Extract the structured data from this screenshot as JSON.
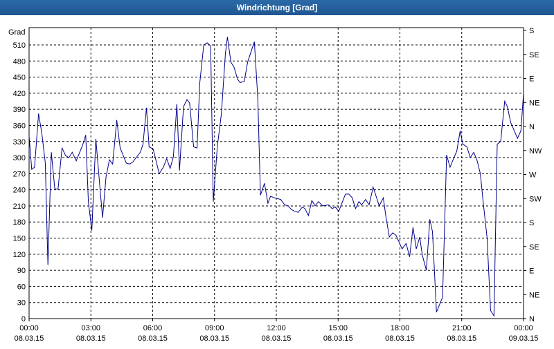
{
  "window": {
    "title": "Windrichtung [Grad]"
  },
  "chart_data": {
    "type": "line",
    "title": "Windrichtung [Grad]",
    "ylabel": "Grad",
    "xlabel": "",
    "ylim": [
      0,
      525
    ],
    "yticks": [
      0,
      30,
      60,
      90,
      120,
      150,
      180,
      210,
      240,
      270,
      300,
      330,
      360,
      390,
      420,
      450,
      480,
      510
    ],
    "y2_labels": [
      {
        "value": 0,
        "label": "N"
      },
      {
        "value": 45,
        "label": "NE"
      },
      {
        "value": 90,
        "label": "E"
      },
      {
        "value": 135,
        "label": "SE"
      },
      {
        "value": 180,
        "label": "S"
      },
      {
        "value": 225,
        "label": "SW"
      },
      {
        "value": 270,
        "label": "W"
      },
      {
        "value": 315,
        "label": "NW"
      },
      {
        "value": 360,
        "label": "N"
      },
      {
        "value": 405,
        "label": "NE"
      },
      {
        "value": 450,
        "label": "E"
      },
      {
        "value": 495,
        "label": "SE"
      },
      {
        "value": 540,
        "label": "S"
      }
    ],
    "xlim": [
      0,
      24
    ],
    "x_unit": "hours since 08.03.15 00:00",
    "xticks": [
      {
        "x": 0,
        "time": "00:00",
        "date": "08.03.15"
      },
      {
        "x": 3,
        "time": "03:00",
        "date": "08.03.15"
      },
      {
        "x": 6,
        "time": "06:00",
        "date": "08.03.15"
      },
      {
        "x": 9,
        "time": "09:00",
        "date": "08.03.15"
      },
      {
        "x": 12,
        "time": "12:00",
        "date": "08.03.15"
      },
      {
        "x": 15,
        "time": "15:00",
        "date": "08.03.15"
      },
      {
        "x": 18,
        "time": "18:00",
        "date": "08.03.15"
      },
      {
        "x": 21,
        "time": "21:00",
        "date": "08.03.15"
      },
      {
        "x": 24,
        "time": "00:00",
        "date": "09.03.15"
      }
    ],
    "grid": true,
    "colors": {
      "line": "#00008b",
      "grid": "#000000",
      "title_bg": "#1f5690"
    },
    "series": [
      {
        "name": "",
        "points": [
          [
            0.0,
            340
          ],
          [
            0.13,
            278
          ],
          [
            0.27,
            282
          ],
          [
            0.47,
            382
          ],
          [
            0.63,
            345
          ],
          [
            0.8,
            290
          ],
          [
            0.93,
            100
          ],
          [
            1.1,
            310
          ],
          [
            1.27,
            242
          ],
          [
            1.43,
            241
          ],
          [
            1.63,
            318
          ],
          [
            1.8,
            304
          ],
          [
            1.97,
            300
          ],
          [
            2.13,
            310
          ],
          [
            2.33,
            294
          ],
          [
            2.63,
            322
          ],
          [
            2.8,
            342
          ],
          [
            2.93,
            218
          ],
          [
            3.1,
            164
          ],
          [
            3.3,
            335
          ],
          [
            3.5,
            244
          ],
          [
            3.63,
            188
          ],
          [
            3.8,
            264
          ],
          [
            3.97,
            296
          ],
          [
            4.13,
            288
          ],
          [
            4.33,
            370
          ],
          [
            4.5,
            318
          ],
          [
            4.8,
            290
          ],
          [
            4.97,
            288
          ],
          [
            5.13,
            292
          ],
          [
            5.5,
            310
          ],
          [
            5.63,
            325
          ],
          [
            5.8,
            393
          ],
          [
            5.93,
            320
          ],
          [
            6.13,
            316
          ],
          [
            6.43,
            270
          ],
          [
            6.63,
            282
          ],
          [
            6.8,
            298
          ],
          [
            6.97,
            280
          ],
          [
            7.13,
            302
          ],
          [
            7.3,
            400
          ],
          [
            7.43,
            276
          ],
          [
            7.63,
            395
          ],
          [
            7.8,
            408
          ],
          [
            7.93,
            402
          ],
          [
            8.13,
            320
          ],
          [
            8.3,
            318
          ],
          [
            8.43,
            438
          ],
          [
            8.63,
            510
          ],
          [
            8.8,
            514
          ],
          [
            8.97,
            508
          ],
          [
            9.1,
            218
          ],
          [
            9.3,
            320
          ],
          [
            9.5,
            382
          ],
          [
            9.7,
            494
          ],
          [
            9.8,
            525
          ],
          [
            9.97,
            478
          ],
          [
            10.13,
            468
          ],
          [
            10.3,
            446
          ],
          [
            10.43,
            440
          ],
          [
            10.63,
            442
          ],
          [
            10.8,
            478
          ],
          [
            11.13,
            516
          ],
          [
            11.3,
            410
          ],
          [
            11.43,
            230
          ],
          [
            11.63,
            252
          ],
          [
            11.8,
            215
          ],
          [
            11.93,
            228
          ],
          [
            12.13,
            225
          ],
          [
            12.43,
            222
          ],
          [
            12.63,
            212
          ],
          [
            12.8,
            210
          ],
          [
            12.97,
            203
          ],
          [
            13.13,
            200
          ],
          [
            13.3,
            198
          ],
          [
            13.5,
            208
          ],
          [
            13.63,
            205
          ],
          [
            13.8,
            192
          ],
          [
            13.97,
            220
          ],
          [
            14.13,
            210
          ],
          [
            14.3,
            218
          ],
          [
            14.5,
            210
          ],
          [
            14.8,
            212
          ],
          [
            14.97,
            205
          ],
          [
            15.13,
            208
          ],
          [
            15.3,
            200
          ],
          [
            15.63,
            232
          ],
          [
            15.8,
            232
          ],
          [
            15.97,
            225
          ],
          [
            16.13,
            205
          ],
          [
            16.3,
            218
          ],
          [
            16.43,
            212
          ],
          [
            16.63,
            222
          ],
          [
            16.8,
            212
          ],
          [
            17.0,
            245
          ],
          [
            17.13,
            230
          ],
          [
            17.3,
            210
          ],
          [
            17.5,
            225
          ],
          [
            17.63,
            190
          ],
          [
            17.8,
            152
          ],
          [
            17.97,
            160
          ],
          [
            18.13,
            155
          ],
          [
            18.43,
            130
          ],
          [
            18.63,
            140
          ],
          [
            18.8,
            115
          ],
          [
            18.97,
            170
          ],
          [
            19.13,
            130
          ],
          [
            19.3,
            152
          ],
          [
            19.43,
            118
          ],
          [
            19.63,
            90
          ],
          [
            19.8,
            185
          ],
          [
            19.93,
            162
          ],
          [
            20.13,
            12
          ],
          [
            20.43,
            40
          ],
          [
            20.63,
            305
          ],
          [
            20.8,
            282
          ],
          [
            20.97,
            298
          ],
          [
            21.13,
            312
          ],
          [
            21.3,
            350
          ],
          [
            21.43,
            325
          ],
          [
            21.63,
            320
          ],
          [
            21.8,
            300
          ],
          [
            21.97,
            310
          ],
          [
            22.13,
            295
          ],
          [
            22.3,
            270
          ],
          [
            22.43,
            220
          ],
          [
            22.63,
            150
          ],
          [
            22.8,
            15
          ],
          [
            22.97,
            5
          ],
          [
            23.13,
            325
          ],
          [
            23.3,
            330
          ],
          [
            23.5,
            405
          ],
          [
            23.63,
            395
          ],
          [
            23.8,
            365
          ],
          [
            23.97,
            350
          ],
          [
            24.13,
            336
          ],
          [
            24.3,
            350
          ],
          [
            24.43,
            420
          ]
        ]
      }
    ]
  }
}
